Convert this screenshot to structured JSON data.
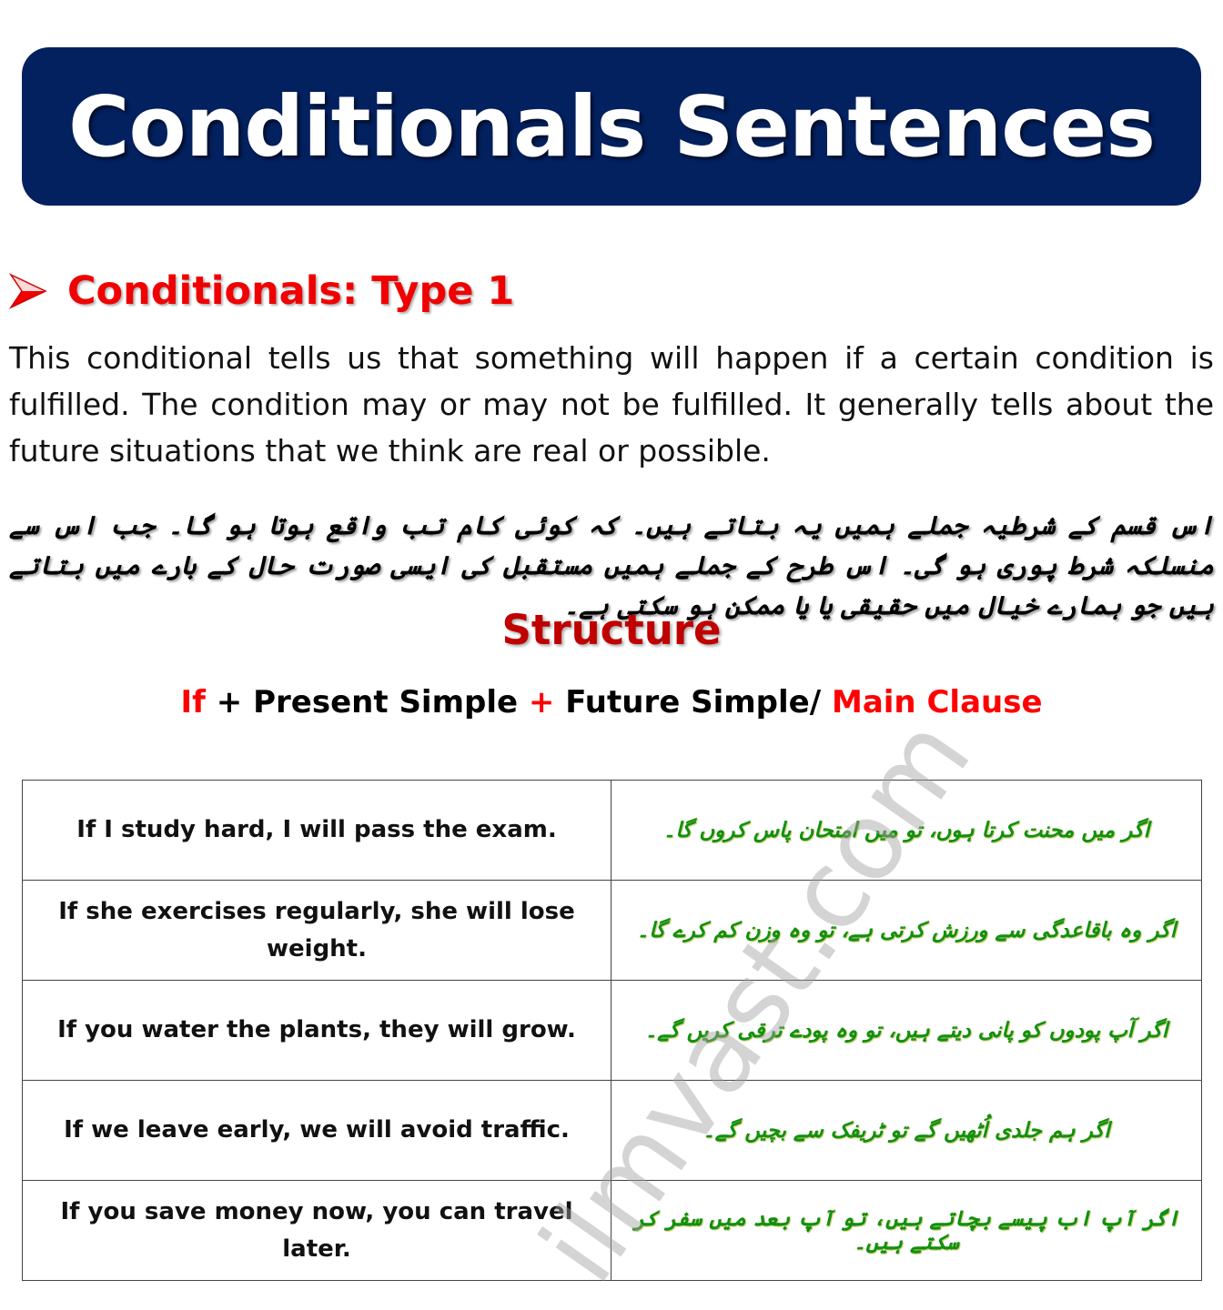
{
  "banner": {
    "title": "Conditionals Sentences",
    "background_color": "#03205f"
  },
  "section": {
    "bullet_icon": "arrow-bullet",
    "title": "Conditionals: Type 1",
    "title_color": "#f00000"
  },
  "description": "This conditional tells us that something will happen if a certain condition is fulfilled. The condition may or may not be fulfilled. It generally tells about the future situations that we think are real or possible.",
  "urdu_description": "اس قسم کے شرطیہ جملے ہمیں یہ بتاتے ہیں۔ کہ کوئی کام تب واقع ہوتا ہو گا۔ جب اس سے منسلکہ شرط پوری ہو گی۔ اس طرح کے جملے ہمیں مستقبل کی ایسی صورت حال کے بارے میں بتاتے ہیں جو ہمارے خیال میں حقیقی یا یا ممکن ہو سکتی ہے۔",
  "structure": {
    "title": "Structure",
    "formula": {
      "part1": "If",
      "part2": " + Present Simple ",
      "part3": "+",
      "part4": " Future Simple/ ",
      "part5": "Main Clause"
    }
  },
  "examples": [
    {
      "english": "If I study hard, I will pass the exam.",
      "urdu": "اگر میں محنت کرتا ہوں، تو میں امتحان پاس کروں گا۔"
    },
    {
      "english": "If she exercises regularly, she will lose weight.",
      "urdu": "اگر وہ باقاعدگی سے ورزش کرتی ہے، تو وہ وزن کم کرے گا۔"
    },
    {
      "english": "If you water the plants, they will grow.",
      "urdu": "اگر آپ پودوں کو پانی دیتے ہیں، تو وہ پودے ترقی کریں گے۔"
    },
    {
      "english": "If we leave early, we will avoid traffic.",
      "urdu": "اگر ہم جلدی اُٹھیں گے تو ٹریفک سے بچیں گے۔"
    },
    {
      "english": "If you save money now, you can travel later.",
      "urdu": "اگر آپ اب پیسے بچاتے ہیں، تو آپ بعد میں سفر کر سکتے ہیں۔"
    }
  ],
  "watermark": "ilmvast.com"
}
